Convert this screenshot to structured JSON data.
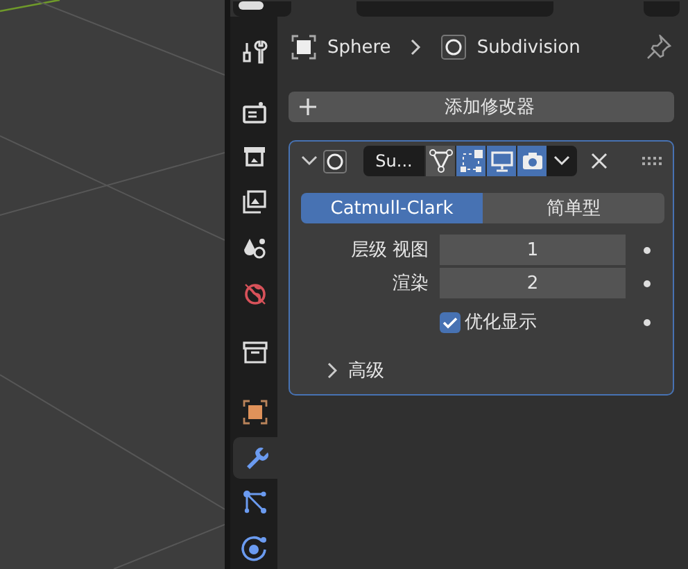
{
  "tabs": [
    {
      "kind": "tool",
      "selected": false,
      "separator_before": false
    },
    {
      "kind": "render",
      "selected": false,
      "separator_before": true
    },
    {
      "kind": "output",
      "selected": false,
      "separator_before": false
    },
    {
      "kind": "view_layer",
      "selected": false,
      "separator_before": false
    },
    {
      "kind": "scene",
      "selected": false,
      "separator_before": false
    },
    {
      "kind": "world",
      "selected": false,
      "separator_before": false
    },
    {
      "kind": "collection",
      "selected": false,
      "separator_before": true
    },
    {
      "kind": "object",
      "selected": false,
      "separator_before": true
    },
    {
      "kind": "modifier",
      "selected": true,
      "separator_before": false
    },
    {
      "kind": "particles",
      "selected": false,
      "separator_before": false
    },
    {
      "kind": "physics",
      "selected": false,
      "separator_before": false
    }
  ],
  "breadcrumb": {
    "object": "Sphere",
    "modifier": "Subdivision"
  },
  "add_modifier_button": "添加修改器",
  "modifier": {
    "name": "Su...",
    "expanded": true,
    "toggles": [
      {
        "kind": "edit_mode",
        "on": false
      },
      {
        "kind": "on_cage",
        "on": true
      },
      {
        "kind": "viewport",
        "on": true
      },
      {
        "kind": "render",
        "on": true
      }
    ],
    "algorithm": [
      {
        "label": "Catmull-Clark",
        "selected": true
      },
      {
        "label": "简单型",
        "selected": false
      }
    ],
    "fields": [
      {
        "label": "层级 视图",
        "value": "1"
      },
      {
        "label": "渲染",
        "value": "2"
      }
    ],
    "optimal_display": {
      "label": "优化显示",
      "checked": true
    },
    "advanced": {
      "label": "高级",
      "expanded": false
    }
  }
}
